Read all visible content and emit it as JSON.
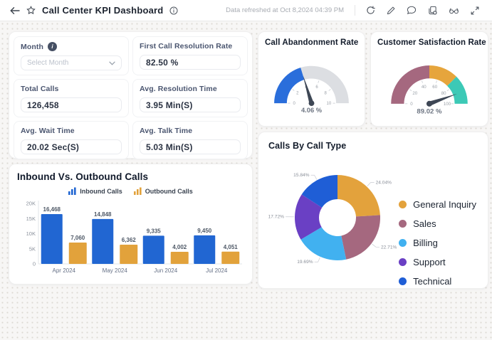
{
  "header": {
    "title": "Call Center KPI Dashboard",
    "refresh_text": "Data refreshed at Oct 8,2024 04:39 PM",
    "icons": [
      "back-icon",
      "star-icon",
      "info-icon",
      "refresh-icon",
      "edit-icon",
      "comment-icon",
      "copy-icon",
      "views-icon",
      "fullscreen-icon"
    ]
  },
  "stats": {
    "month": {
      "label": "Month",
      "placeholder": "Select Month"
    },
    "tiles": [
      {
        "label": "First Call Resolution Rate",
        "value": "82.50 %"
      },
      {
        "label": "Total Calls",
        "value": "126,458"
      },
      {
        "label": "Avg. Resolution Time",
        "value": "3.95 Min(S)"
      },
      {
        "label": "Avg. Wait Time",
        "value": "20.02 Sec(S)"
      },
      {
        "label": "Avg. Talk Time",
        "value": "5.03 Min(S)"
      }
    ]
  },
  "colors": {
    "needle": "#3e4755",
    "axis": "#e2e4e8",
    "muted_text": "#8a919c"
  },
  "chart_data": [
    {
      "type": "gauge",
      "title": "Call Abandonment Rate",
      "value": 4.06,
      "value_label": "4.06 %",
      "min": 0,
      "max": 10,
      "ticks": [
        0,
        2,
        4,
        6,
        8,
        10
      ],
      "segments": [
        {
          "from": 0,
          "to": 4.06,
          "color": "#2a6edb"
        },
        {
          "from": 4.06,
          "to": 10,
          "color": "#dcdee2"
        }
      ]
    },
    {
      "type": "gauge",
      "title": "Customer Satisfaction Rate",
      "value": 89.02,
      "value_label": "89.02 %",
      "min": 0,
      "max": 100,
      "ticks": [
        0,
        20,
        40,
        60,
        80,
        100
      ],
      "segments": [
        {
          "from": 0,
          "to": 50,
          "color": "#a5687f"
        },
        {
          "from": 50,
          "to": 75,
          "color": "#e6a53c"
        },
        {
          "from": 75,
          "to": 100,
          "color": "#3cc9b6"
        }
      ]
    },
    {
      "type": "pie",
      "title": "Calls By Call Type",
      "slices": [
        {
          "label": "General Inquiry",
          "value": 24.04,
          "display": "24.04%",
          "color": "#e3a23c"
        },
        {
          "label": "Sales",
          "value": 22.71,
          "display": "22.71%",
          "color": "#a5687f"
        },
        {
          "label": "Billing",
          "value": 19.69,
          "display": "19.69%",
          "color": "#41b1f0"
        },
        {
          "label": "Support",
          "value": 17.72,
          "display": "17.72%",
          "color": "#6a40c4"
        },
        {
          "label": "Technical",
          "value": 15.84,
          "display": "15.84%",
          "color": "#1f5ed6"
        }
      ]
    },
    {
      "type": "bar",
      "title": "Inbound Vs. Outbound Calls",
      "categories": [
        "Apr 2024",
        "May 2024",
        "Jun 2024",
        "Jul 2024"
      ],
      "series": [
        {
          "name": "Inbound Calls",
          "color": "#2166d2",
          "values": [
            16468,
            14848,
            9335,
            9450
          ],
          "labels": [
            "16,468",
            "14,848",
            "9,335",
            "9,450"
          ]
        },
        {
          "name": "Outbound Calls",
          "color": "#e2a23b",
          "values": [
            7060,
            6362,
            4002,
            4051
          ],
          "labels": [
            "7,060",
            "6,362",
            "4,002",
            "4,051"
          ]
        }
      ],
      "y_ticks": [
        {
          "v": 0,
          "label": "0"
        },
        {
          "v": 5000,
          "label": "5K"
        },
        {
          "v": 10000,
          "label": "10K"
        },
        {
          "v": 15000,
          "label": "15K"
        },
        {
          "v": 20000,
          "label": "20K"
        }
      ],
      "ylim": [
        0,
        20000
      ]
    }
  ]
}
